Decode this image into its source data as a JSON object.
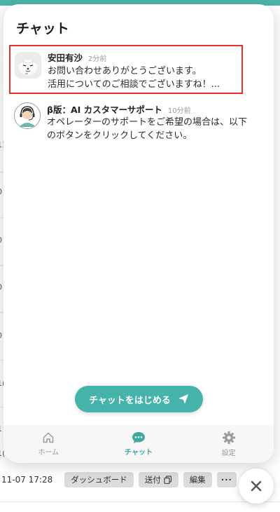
{
  "panel": {
    "title": "チャット",
    "start_button_label": "チャットをはじめる"
  },
  "conversations": [
    {
      "sender": "安田有沙",
      "time": "2分前",
      "preview": "お問い合わせありがとうございます。\n活用についてのご相談でございますね！...",
      "highlighted": true
    },
    {
      "sender": "β版：AI カスタマーサポート",
      "time": "10分前",
      "preview": "オペレーターのサポートをご希望の場合は、以下\nのボタンをクリックしてください。",
      "highlighted": false
    }
  ],
  "nav": {
    "items": [
      {
        "label": "ホーム",
        "icon": "home-icon",
        "active": false
      },
      {
        "label": "チャット",
        "icon": "chat-icon",
        "active": true
      },
      {
        "label": "設定",
        "icon": "gear-icon",
        "active": false
      }
    ]
  },
  "background": {
    "row_date": "11-07 17:28",
    "dashboard_button": "ダッシュボード",
    "send_button": "送付",
    "edit_button": "編集",
    "more_button": "···",
    "edge_marks": [
      "11",
      "0",
      "0",
      "0",
      "0",
      "1(",
      "1",
      "1("
    ]
  },
  "colors": {
    "accent": "#45b3aa",
    "highlight_border": "#e3302a"
  }
}
